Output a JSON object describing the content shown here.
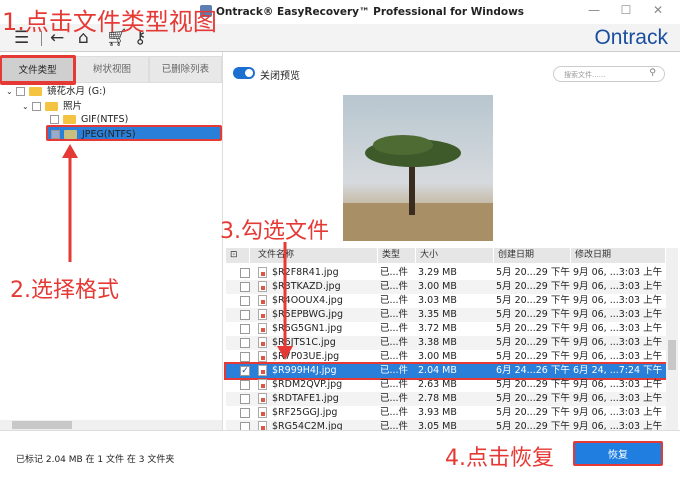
{
  "window": {
    "title": "Ontrack® EasyRecovery™ Professional for Windows",
    "logo": "Ontrack",
    "controls": [
      "minimize",
      "maximize",
      "close"
    ]
  },
  "toolbar": {
    "icons": [
      "menu-icon",
      "back-icon",
      "home-icon",
      "cart-icon",
      "key-icon"
    ]
  },
  "tabs": [
    {
      "label": "文件类型",
      "active": true
    },
    {
      "label": "树状视图"
    },
    {
      "label": "已删除列表"
    }
  ],
  "tree": [
    {
      "label": "镜花水月 (G:)",
      "level": 0
    },
    {
      "label": "照片",
      "level": 1
    },
    {
      "label": "GIF(NTFS)",
      "level": 2
    },
    {
      "label": "JPEG(NTFS)",
      "level": 2,
      "selected": true
    }
  ],
  "preview": {
    "toggle_label": "关闭预览",
    "toggle_on": true
  },
  "search": {
    "placeholder": "搜索文件......"
  },
  "table": {
    "headers": [
      "文件名称",
      "类型",
      "大小",
      "创建日期",
      "修改日期"
    ],
    "rows": [
      {
        "name": "$R2F8R41.jpg",
        "type": "已...件",
        "size": "3.29 MB",
        "created": "5月 20...29 下午",
        "modified": "9月 06, ...3:03 上午",
        "checked": false
      },
      {
        "name": "$R3TKAZD.jpg",
        "type": "已...件",
        "size": "3.00 MB",
        "created": "5月 20...29 下午",
        "modified": "9月 06, ...3:03 上午",
        "checked": false
      },
      {
        "name": "$R4OOUX4.jpg",
        "type": "已...件",
        "size": "3.03 MB",
        "created": "5月 20...29 下午",
        "modified": "9月 06, ...3:03 上午",
        "checked": false
      },
      {
        "name": "$R5EPBWG.jpg",
        "type": "已...件",
        "size": "3.35 MB",
        "created": "5月 20...29 下午",
        "modified": "9月 06, ...3:03 上午",
        "checked": false
      },
      {
        "name": "$R6G5GN1.jpg",
        "type": "已...件",
        "size": "3.72 MB",
        "created": "5月 20...29 下午",
        "modified": "9月 06, ...3:03 上午",
        "checked": false
      },
      {
        "name": "$R6JTS1C.jpg",
        "type": "已...件",
        "size": "3.38 MB",
        "created": "5月 20...29 下午",
        "modified": "9月 06, ...3:03 上午",
        "checked": false
      },
      {
        "name": "$R7P03UE.jpg",
        "type": "已...件",
        "size": "3.00 MB",
        "created": "5月 20...29 下午",
        "modified": "9月 06, ...3:03 上午",
        "checked": false
      },
      {
        "name": "$R999H4J.jpg",
        "type": "已...件",
        "size": "2.04 MB",
        "created": "6月 24...26 下午",
        "modified": "6月 24, ...7:24 下午",
        "checked": true,
        "selected": true
      },
      {
        "name": "$RDM2QVP.jpg",
        "type": "已...件",
        "size": "2.63 MB",
        "created": "5月 20...29 下午",
        "modified": "9月 06, ...3:03 上午",
        "checked": false
      },
      {
        "name": "$RDTAFE1.jpg",
        "type": "已...件",
        "size": "2.78 MB",
        "created": "5月 20...29 下午",
        "modified": "9月 06, ...3:03 上午",
        "checked": false
      },
      {
        "name": "$RF25GGJ.jpg",
        "type": "已...件",
        "size": "3.93 MB",
        "created": "5月 20...29 下午",
        "modified": "9月 06, ...3:03 上午",
        "checked": false
      },
      {
        "name": "$RG54C2M.jpg",
        "type": "已...件",
        "size": "3.05 MB",
        "created": "5月 20...29 下午",
        "modified": "9月 06, ...3:03 上午",
        "checked": false
      }
    ]
  },
  "status": "已标记 2.04 MB 在 1 文件 在 3 文件夹",
  "recover_label": "恢复",
  "annotations": [
    "1.点击文件类型视图",
    "2.选择格式",
    "3.勾选文件",
    "4.点击恢复"
  ],
  "colors": {
    "accent": "#1f7ee0",
    "annotation": "#e53935",
    "logo": "#1a4fa0",
    "selection": "#2a7fd9"
  }
}
